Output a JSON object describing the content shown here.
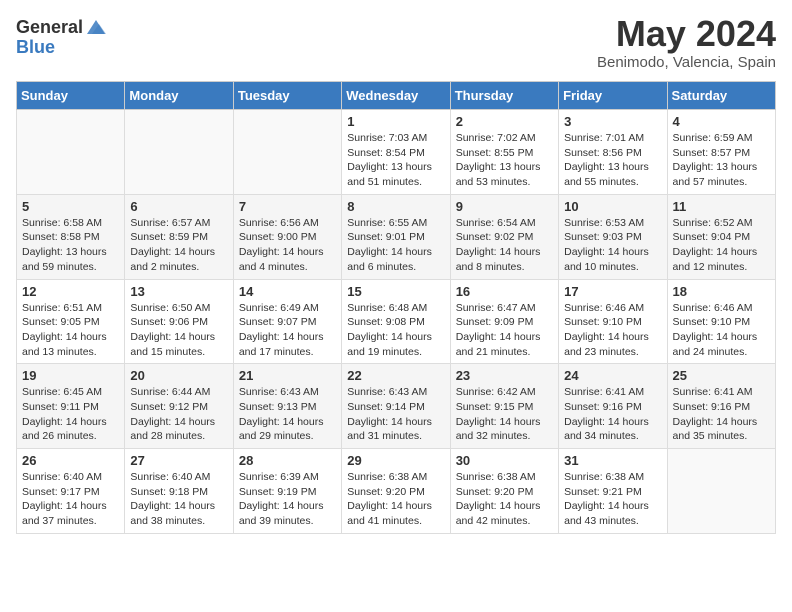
{
  "header": {
    "logo_general": "General",
    "logo_blue": "Blue",
    "month_title": "May 2024",
    "subtitle": "Benimodo, Valencia, Spain"
  },
  "weekdays": [
    "Sunday",
    "Monday",
    "Tuesday",
    "Wednesday",
    "Thursday",
    "Friday",
    "Saturday"
  ],
  "weeks": [
    [
      {
        "day": "",
        "sunrise": "",
        "sunset": "",
        "daylight": ""
      },
      {
        "day": "",
        "sunrise": "",
        "sunset": "",
        "daylight": ""
      },
      {
        "day": "",
        "sunrise": "",
        "sunset": "",
        "daylight": ""
      },
      {
        "day": "1",
        "sunrise": "Sunrise: 7:03 AM",
        "sunset": "Sunset: 8:54 PM",
        "daylight": "Daylight: 13 hours and 51 minutes."
      },
      {
        "day": "2",
        "sunrise": "Sunrise: 7:02 AM",
        "sunset": "Sunset: 8:55 PM",
        "daylight": "Daylight: 13 hours and 53 minutes."
      },
      {
        "day": "3",
        "sunrise": "Sunrise: 7:01 AM",
        "sunset": "Sunset: 8:56 PM",
        "daylight": "Daylight: 13 hours and 55 minutes."
      },
      {
        "day": "4",
        "sunrise": "Sunrise: 6:59 AM",
        "sunset": "Sunset: 8:57 PM",
        "daylight": "Daylight: 13 hours and 57 minutes."
      }
    ],
    [
      {
        "day": "5",
        "sunrise": "Sunrise: 6:58 AM",
        "sunset": "Sunset: 8:58 PM",
        "daylight": "Daylight: 13 hours and 59 minutes."
      },
      {
        "day": "6",
        "sunrise": "Sunrise: 6:57 AM",
        "sunset": "Sunset: 8:59 PM",
        "daylight": "Daylight: 14 hours and 2 minutes."
      },
      {
        "day": "7",
        "sunrise": "Sunrise: 6:56 AM",
        "sunset": "Sunset: 9:00 PM",
        "daylight": "Daylight: 14 hours and 4 minutes."
      },
      {
        "day": "8",
        "sunrise": "Sunrise: 6:55 AM",
        "sunset": "Sunset: 9:01 PM",
        "daylight": "Daylight: 14 hours and 6 minutes."
      },
      {
        "day": "9",
        "sunrise": "Sunrise: 6:54 AM",
        "sunset": "Sunset: 9:02 PM",
        "daylight": "Daylight: 14 hours and 8 minutes."
      },
      {
        "day": "10",
        "sunrise": "Sunrise: 6:53 AM",
        "sunset": "Sunset: 9:03 PM",
        "daylight": "Daylight: 14 hours and 10 minutes."
      },
      {
        "day": "11",
        "sunrise": "Sunrise: 6:52 AM",
        "sunset": "Sunset: 9:04 PM",
        "daylight": "Daylight: 14 hours and 12 minutes."
      }
    ],
    [
      {
        "day": "12",
        "sunrise": "Sunrise: 6:51 AM",
        "sunset": "Sunset: 9:05 PM",
        "daylight": "Daylight: 14 hours and 13 minutes."
      },
      {
        "day": "13",
        "sunrise": "Sunrise: 6:50 AM",
        "sunset": "Sunset: 9:06 PM",
        "daylight": "Daylight: 14 hours and 15 minutes."
      },
      {
        "day": "14",
        "sunrise": "Sunrise: 6:49 AM",
        "sunset": "Sunset: 9:07 PM",
        "daylight": "Daylight: 14 hours and 17 minutes."
      },
      {
        "day": "15",
        "sunrise": "Sunrise: 6:48 AM",
        "sunset": "Sunset: 9:08 PM",
        "daylight": "Daylight: 14 hours and 19 minutes."
      },
      {
        "day": "16",
        "sunrise": "Sunrise: 6:47 AM",
        "sunset": "Sunset: 9:09 PM",
        "daylight": "Daylight: 14 hours and 21 minutes."
      },
      {
        "day": "17",
        "sunrise": "Sunrise: 6:46 AM",
        "sunset": "Sunset: 9:10 PM",
        "daylight": "Daylight: 14 hours and 23 minutes."
      },
      {
        "day": "18",
        "sunrise": "Sunrise: 6:46 AM",
        "sunset": "Sunset: 9:10 PM",
        "daylight": "Daylight: 14 hours and 24 minutes."
      }
    ],
    [
      {
        "day": "19",
        "sunrise": "Sunrise: 6:45 AM",
        "sunset": "Sunset: 9:11 PM",
        "daylight": "Daylight: 14 hours and 26 minutes."
      },
      {
        "day": "20",
        "sunrise": "Sunrise: 6:44 AM",
        "sunset": "Sunset: 9:12 PM",
        "daylight": "Daylight: 14 hours and 28 minutes."
      },
      {
        "day": "21",
        "sunrise": "Sunrise: 6:43 AM",
        "sunset": "Sunset: 9:13 PM",
        "daylight": "Daylight: 14 hours and 29 minutes."
      },
      {
        "day": "22",
        "sunrise": "Sunrise: 6:43 AM",
        "sunset": "Sunset: 9:14 PM",
        "daylight": "Daylight: 14 hours and 31 minutes."
      },
      {
        "day": "23",
        "sunrise": "Sunrise: 6:42 AM",
        "sunset": "Sunset: 9:15 PM",
        "daylight": "Daylight: 14 hours and 32 minutes."
      },
      {
        "day": "24",
        "sunrise": "Sunrise: 6:41 AM",
        "sunset": "Sunset: 9:16 PM",
        "daylight": "Daylight: 14 hours and 34 minutes."
      },
      {
        "day": "25",
        "sunrise": "Sunrise: 6:41 AM",
        "sunset": "Sunset: 9:16 PM",
        "daylight": "Daylight: 14 hours and 35 minutes."
      }
    ],
    [
      {
        "day": "26",
        "sunrise": "Sunrise: 6:40 AM",
        "sunset": "Sunset: 9:17 PM",
        "daylight": "Daylight: 14 hours and 37 minutes."
      },
      {
        "day": "27",
        "sunrise": "Sunrise: 6:40 AM",
        "sunset": "Sunset: 9:18 PM",
        "daylight": "Daylight: 14 hours and 38 minutes."
      },
      {
        "day": "28",
        "sunrise": "Sunrise: 6:39 AM",
        "sunset": "Sunset: 9:19 PM",
        "daylight": "Daylight: 14 hours and 39 minutes."
      },
      {
        "day": "29",
        "sunrise": "Sunrise: 6:38 AM",
        "sunset": "Sunset: 9:20 PM",
        "daylight": "Daylight: 14 hours and 41 minutes."
      },
      {
        "day": "30",
        "sunrise": "Sunrise: 6:38 AM",
        "sunset": "Sunset: 9:20 PM",
        "daylight": "Daylight: 14 hours and 42 minutes."
      },
      {
        "day": "31",
        "sunrise": "Sunrise: 6:38 AM",
        "sunset": "Sunset: 9:21 PM",
        "daylight": "Daylight: 14 hours and 43 minutes."
      },
      {
        "day": "",
        "sunrise": "",
        "sunset": "",
        "daylight": ""
      }
    ]
  ]
}
